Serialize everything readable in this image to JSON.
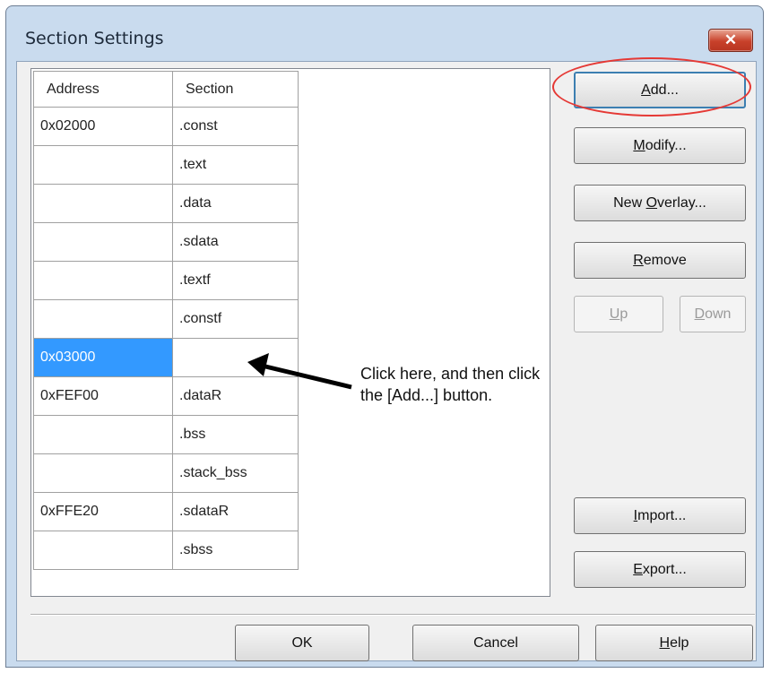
{
  "window": {
    "title": "Section Settings",
    "close_symbol": "✕"
  },
  "table": {
    "headers": [
      "Address",
      "Section"
    ],
    "rows": [
      {
        "address": "0x02000",
        "section": ".const"
      },
      {
        "address": "",
        "section": ".text"
      },
      {
        "address": "",
        "section": ".data"
      },
      {
        "address": "",
        "section": ".sdata"
      },
      {
        "address": "",
        "section": ".textf"
      },
      {
        "address": "",
        "section": ".constf"
      },
      {
        "address": "0x03000",
        "section": "",
        "selected": true
      },
      {
        "address": "0xFEF00",
        "section": ".dataR"
      },
      {
        "address": "",
        "section": ".bss"
      },
      {
        "address": "",
        "section": ".stack_bss"
      },
      {
        "address": "0xFFE20",
        "section": ".sdataR"
      },
      {
        "address": "",
        "section": ".sbss"
      }
    ]
  },
  "buttons": {
    "add": {
      "hot": "A",
      "rest": "dd..."
    },
    "modify": {
      "hot": "M",
      "rest": "odify..."
    },
    "new_overlay": {
      "pre": "New ",
      "hot": "O",
      "rest": "verlay..."
    },
    "remove": {
      "hot": "R",
      "rest": "emove"
    },
    "up": {
      "hot": "U",
      "rest": "p"
    },
    "down": {
      "hot": "D",
      "rest": "own"
    },
    "import": {
      "hot": "I",
      "rest": "mport..."
    },
    "export": {
      "hot": "E",
      "rest": "xport..."
    },
    "ok": "OK",
    "cancel": "Cancel",
    "help": {
      "hot": "H",
      "rest": "elp"
    }
  },
  "annotation": {
    "line1": "Click here, and then click",
    "line2": "the [Add...] button."
  },
  "colors": {
    "selection": "#3399ff",
    "highlight_ellipse": "#e53935",
    "title_bar": "#c9dbee"
  }
}
